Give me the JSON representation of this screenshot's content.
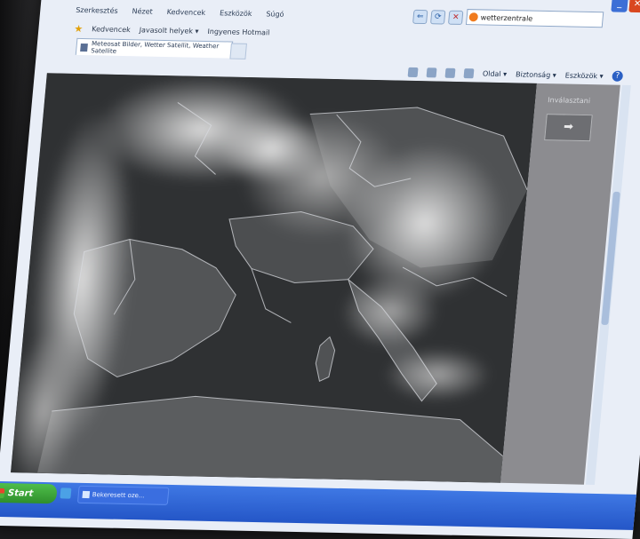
{
  "menu": {
    "items": [
      "Szerkesztés",
      "Nézet",
      "Kedvencek",
      "Eszközök",
      "Súgó"
    ]
  },
  "nav": {
    "back_glyph": "⇐",
    "refresh_glyph": "⟳",
    "stop_glyph": "✕"
  },
  "search": {
    "value": "wetterzentrale"
  },
  "window": {
    "minimize": "_",
    "close": "✕"
  },
  "favorites": {
    "label": "Kedvencek",
    "items": [
      "Javasolt helyek ▾",
      "Ingyenes Hotmail"
    ]
  },
  "tab": {
    "title": "Meteosat Bilder, Wetter Satellit, Weather Satellite"
  },
  "commandbar": {
    "page": "Oldal ▾",
    "safety": "Biztonság ▾",
    "tools": "Eszközök ▾",
    "help_glyph": "?"
  },
  "side": {
    "label": "Inválasztani",
    "arrow_glyph": "➡"
  },
  "taskbar": {
    "start_label": "Start",
    "task_label": "Bekeresett oze..."
  },
  "colors": {
    "accent": "#2456c7",
    "start_green": "#2f8f2c",
    "sat_background": "#303234"
  }
}
